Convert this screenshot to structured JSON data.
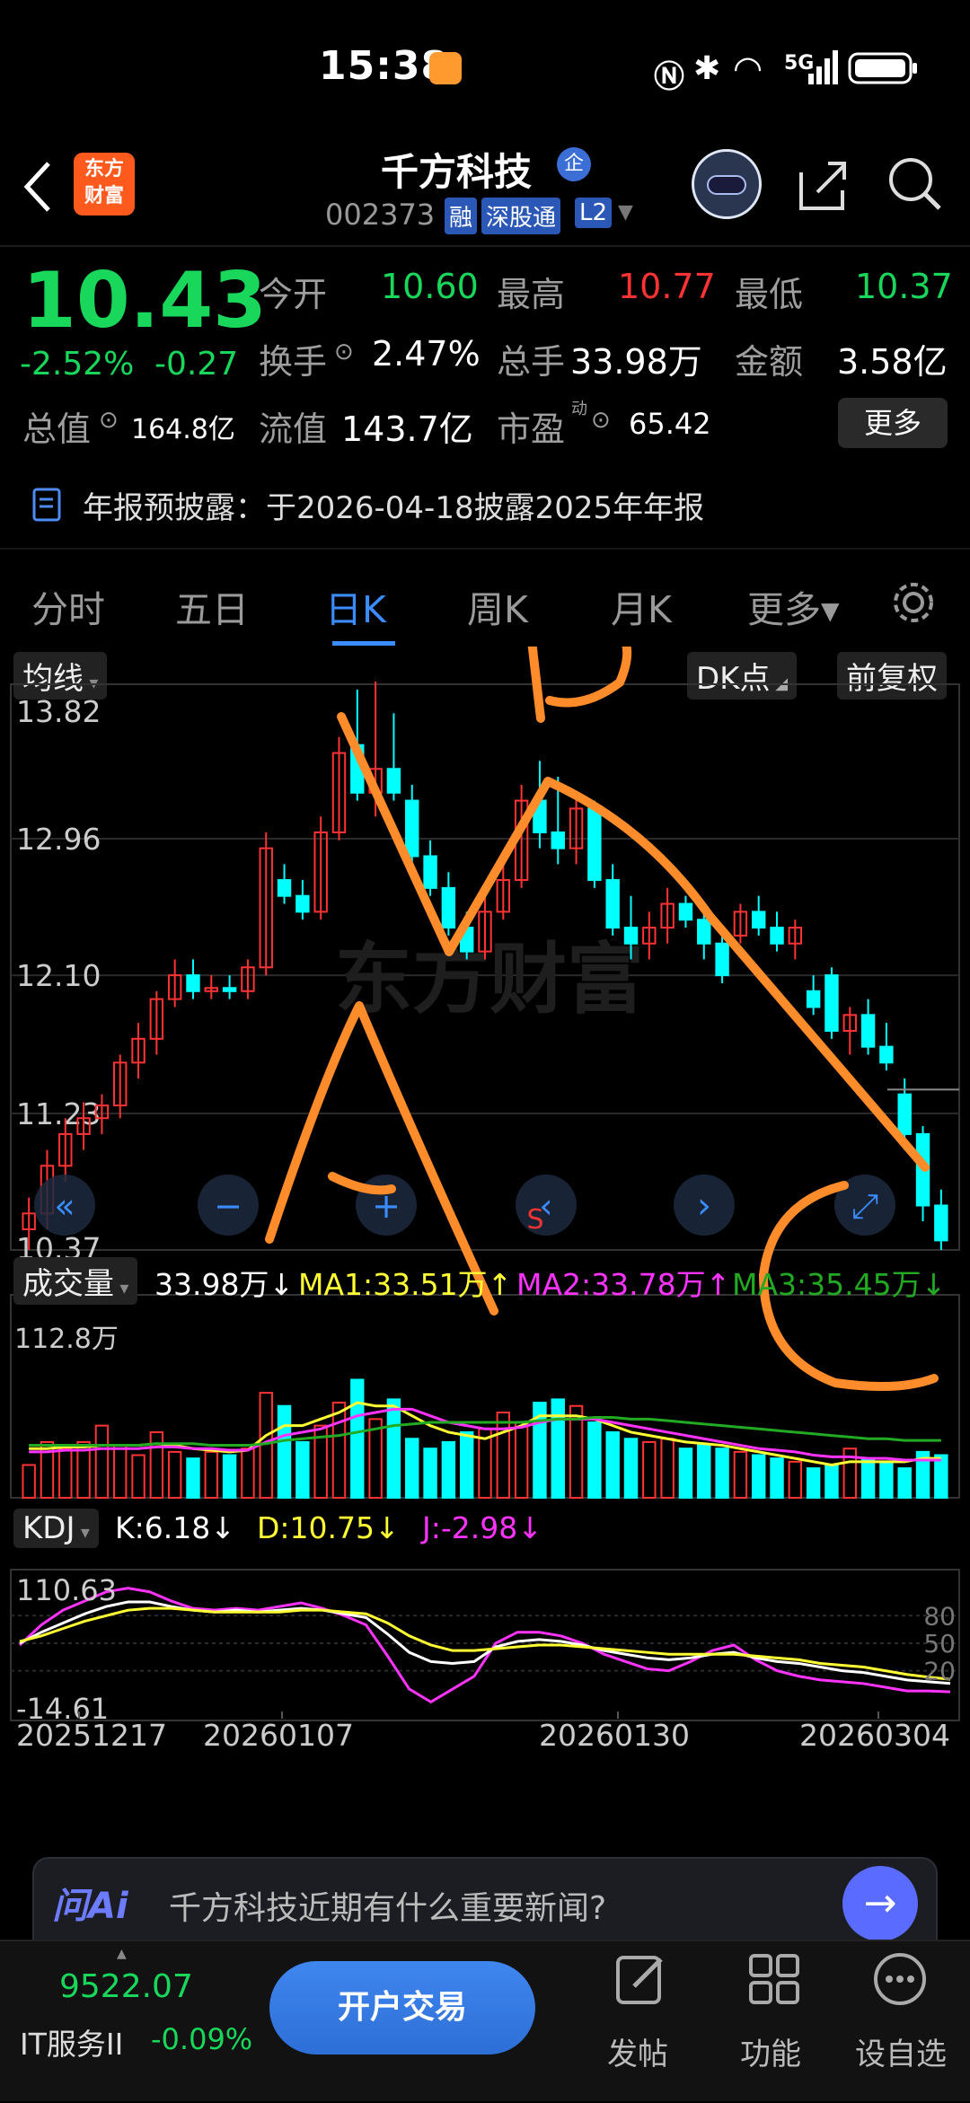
{
  "status_bar": {
    "time": "15:38",
    "network": "5G"
  },
  "header": {
    "back_icon": "chevron-left-icon",
    "app_logo": "东方\n财富",
    "stock_name": "千方科技",
    "enterprise_badge": "企",
    "stock_code": "002373",
    "tags": [
      "融",
      "深股通",
      "L2"
    ],
    "assistant_icon": "robot-avatar-icon",
    "share_icon": "share-icon",
    "search_icon": "search-icon"
  },
  "quote": {
    "price": "10.43",
    "change_pct": "-2.52%",
    "change": "-0.27",
    "open_label": "今开",
    "open": "10.60",
    "high_label": "最高",
    "high": "10.77",
    "low_label": "最低",
    "low": "10.37",
    "turnover_label": "换手",
    "turnover": "2.47%",
    "volume_label": "总手",
    "volume": "33.98万",
    "amount_label": "金额",
    "amount": "3.58亿",
    "mcap_label": "总值",
    "mcap": "164.8亿",
    "float_label": "流值",
    "float": "143.7亿",
    "pe_label": "市盈",
    "pe_sup": "动",
    "pe": "65.42",
    "more_button": "更多"
  },
  "notice": {
    "icon": "document-icon",
    "text": "年报预披露：于2026-04-18披露2025年年报"
  },
  "tabs": [
    "分时",
    "五日",
    "日K",
    "周K",
    "月K",
    "更多▾"
  ],
  "active_tab": "日K",
  "chart_toolbar": {
    "ma_button": "均线",
    "dk_button": "DK点",
    "adjust_button": "前复权"
  },
  "watermark": "东方财富",
  "chart_data": [
    {
      "type": "candlestick",
      "title": "日K",
      "ylim": [
        10.37,
        13.82
      ],
      "y_ticks": [
        "13.82",
        "12.96",
        "12.10",
        "11.23",
        "10.37"
      ],
      "x_ticks": [
        "20251217",
        "20260107",
        "20260130",
        "20260304"
      ],
      "candles": [
        [
          10.5,
          10.7,
          10.37,
          10.6
        ],
        [
          10.6,
          11.0,
          10.5,
          10.9
        ],
        [
          10.9,
          11.2,
          10.8,
          11.1
        ],
        [
          11.1,
          11.3,
          11.0,
          11.2
        ],
        [
          11.2,
          11.35,
          11.1,
          11.28
        ],
        [
          11.28,
          11.6,
          11.2,
          11.55
        ],
        [
          11.55,
          11.8,
          11.45,
          11.7
        ],
        [
          11.7,
          12.0,
          11.6,
          11.95
        ],
        [
          11.95,
          12.2,
          11.9,
          12.1
        ],
        [
          12.1,
          12.2,
          11.95,
          12.0
        ],
        [
          12.0,
          12.1,
          11.95,
          12.02
        ],
        [
          12.02,
          12.1,
          11.95,
          12.0
        ],
        [
          12.0,
          12.2,
          11.95,
          12.15
        ],
        [
          12.15,
          13.0,
          12.1,
          12.9
        ],
        [
          12.7,
          12.8,
          12.55,
          12.6
        ],
        [
          12.6,
          12.7,
          12.45,
          12.5
        ],
        [
          12.5,
          13.1,
          12.45,
          13.0
        ],
        [
          13.0,
          13.6,
          12.95,
          13.5
        ],
        [
          13.55,
          13.9,
          13.2,
          13.25
        ],
        [
          13.25,
          13.95,
          13.1,
          13.4
        ],
        [
          13.4,
          13.75,
          13.2,
          13.25
        ],
        [
          13.2,
          13.3,
          12.8,
          12.85
        ],
        [
          12.85,
          12.95,
          12.6,
          12.65
        ],
        [
          12.65,
          12.75,
          12.35,
          12.4
        ],
        [
          12.4,
          12.5,
          12.2,
          12.25
        ],
        [
          12.25,
          12.6,
          12.2,
          12.5
        ],
        [
          12.5,
          12.8,
          12.45,
          12.7
        ],
        [
          12.7,
          13.3,
          12.65,
          13.2
        ],
        [
          13.2,
          13.45,
          12.9,
          13.0
        ],
        [
          13.0,
          13.35,
          12.8,
          12.9
        ],
        [
          12.9,
          13.25,
          12.8,
          13.15
        ],
        [
          13.15,
          13.2,
          12.65,
          12.7
        ],
        [
          12.7,
          12.8,
          12.35,
          12.4
        ],
        [
          12.4,
          12.6,
          12.2,
          12.3
        ],
        [
          12.3,
          12.5,
          12.2,
          12.4
        ],
        [
          12.4,
          12.65,
          12.3,
          12.55
        ],
        [
          12.55,
          12.6,
          12.4,
          12.45
        ],
        [
          12.45,
          12.5,
          12.2,
          12.3
        ],
        [
          12.3,
          12.4,
          12.05,
          12.1
        ],
        [
          12.35,
          12.55,
          12.3,
          12.5
        ],
        [
          12.5,
          12.6,
          12.35,
          12.4
        ],
        [
          12.4,
          12.5,
          12.25,
          12.3
        ],
        [
          12.3,
          12.45,
          12.2,
          12.4
        ],
        [
          12.0,
          12.1,
          11.85,
          11.9
        ],
        [
          12.1,
          12.15,
          11.7,
          11.75
        ],
        [
          11.75,
          11.9,
          11.6,
          11.85
        ],
        [
          11.85,
          11.95,
          11.6,
          11.65
        ],
        [
          11.65,
          11.8,
          11.5,
          11.55
        ],
        [
          11.35,
          11.45,
          11.0,
          11.1
        ],
        [
          11.1,
          11.15,
          10.55,
          10.65
        ],
        [
          10.65,
          10.75,
          10.37,
          10.43
        ]
      ]
    },
    {
      "type": "bar",
      "title": "成交量",
      "legend": [
        "33.98万↓",
        "MA1:33.51万↑",
        "MA2:33.78万↑",
        "MA3:35.45万↓"
      ],
      "ylim": [
        0,
        112.8
      ],
      "y_max_label": "112.8万",
      "values": [
        20,
        34,
        30,
        34,
        44,
        32,
        26,
        40,
        28,
        24,
        28,
        26,
        30,
        64,
        56,
        34,
        44,
        58,
        72,
        48,
        60,
        36,
        30,
        34,
        40,
        42,
        52,
        46,
        58,
        60,
        56,
        46,
        40,
        36,
        34,
        36,
        30,
        32,
        30,
        28,
        26,
        24,
        22,
        18,
        20,
        30,
        24,
        22,
        18,
        28,
        26
      ],
      "ma1": [
        30,
        30,
        31,
        31,
        32,
        32,
        32,
        33,
        32,
        30,
        29,
        28,
        29,
        38,
        44,
        44,
        48,
        52,
        58,
        56,
        56,
        50,
        44,
        40,
        38,
        36,
        40,
        44,
        50,
        50,
        50,
        48,
        44,
        40,
        38,
        36,
        34,
        33,
        32,
        30,
        28,
        26,
        24,
        22,
        20,
        22,
        22,
        22,
        22,
        24,
        24
      ],
      "ma2": [
        28,
        28,
        29,
        29,
        30,
        30,
        30,
        31,
        31,
        30,
        30,
        29,
        29,
        34,
        38,
        40,
        42,
        46,
        50,
        52,
        54,
        54,
        50,
        46,
        44,
        42,
        42,
        43,
        46,
        48,
        48,
        48,
        46,
        44,
        42,
        40,
        38,
        36,
        34,
        32,
        30,
        29,
        28,
        26,
        25,
        25,
        24,
        24,
        23,
        23,
        23
      ],
      "ma3": [
        32,
        32,
        32,
        32,
        32,
        32,
        32,
        33,
        33,
        33,
        32,
        32,
        32,
        33,
        35,
        36,
        37,
        38,
        40,
        42,
        44,
        45,
        46,
        46,
        46,
        46,
        46,
        46,
        47,
        48,
        48,
        49,
        49,
        48,
        48,
        47,
        46,
        45,
        44,
        43,
        42,
        41,
        40,
        39,
        38,
        37,
        36,
        36,
        35,
        35,
        35
      ]
    },
    {
      "type": "line",
      "title": "KDJ",
      "legend": [
        "K:6.18↓",
        "D:10.75↓",
        "J:-2.98↓"
      ],
      "ylim": [
        -14.61,
        110.63
      ],
      "y_ticks_left": [
        "110.63",
        "-14.61"
      ],
      "y_ticks_right": [
        "80",
        "50",
        "20"
      ],
      "k": [
        50,
        62,
        72,
        82,
        90,
        95,
        95,
        90,
        86,
        84,
        86,
        84,
        86,
        88,
        86,
        82,
        78,
        60,
        40,
        30,
        28,
        30,
        46,
        52,
        54,
        52,
        48,
        42,
        38,
        34,
        32,
        34,
        38,
        40,
        34,
        30,
        28,
        24,
        20,
        18,
        14,
        10,
        8,
        6.18
      ],
      "d": [
        52,
        58,
        66,
        74,
        80,
        86,
        88,
        88,
        86,
        84,
        84,
        84,
        84,
        86,
        86,
        84,
        82,
        72,
        58,
        48,
        42,
        42,
        44,
        46,
        48,
        48,
        46,
        44,
        42,
        40,
        38,
        38,
        38,
        38,
        36,
        34,
        32,
        28,
        26,
        24,
        20,
        16,
        13,
        10.75
      ],
      "j": [
        48,
        70,
        86,
        96,
        106,
        110,
        106,
        96,
        88,
        86,
        88,
        86,
        90,
        94,
        88,
        80,
        70,
        36,
        0,
        -14,
        0,
        14,
        50,
        62,
        62,
        58,
        50,
        38,
        30,
        22,
        20,
        30,
        42,
        48,
        32,
        20,
        14,
        10,
        8,
        6,
        2,
        -2,
        -2,
        -2.98
      ]
    }
  ],
  "chart_controls": [
    "rewind-icon",
    "zoom-out-icon",
    "zoom-in-icon",
    "prev-icon",
    "next-icon",
    "expand-icon"
  ],
  "ma_overlay": {
    "label": "S"
  },
  "annotations": [
    "B",
    "A",
    "C"
  ],
  "ask_ai": {
    "logo": "问Ai",
    "placeholder": "千方科技近期有什么重要新闻?",
    "send_icon": "arrow-right-icon"
  },
  "bottom_bar": {
    "index_value": "9522.07",
    "index_name": "IT服务II",
    "index_change": "-0.09%",
    "trade_button": "开户交易",
    "post_label": "发帖",
    "func_label": "功能",
    "watch_label": "设自选"
  },
  "colors": {
    "up": "#ff3333",
    "down": "#19d75b",
    "candle_down": "#00ffff",
    "accent": "#3b8cff",
    "annotation": "#ff8c2a",
    "ma1": "#ffff33",
    "ma2": "#ff33ff",
    "ma3": "#22aa22"
  }
}
